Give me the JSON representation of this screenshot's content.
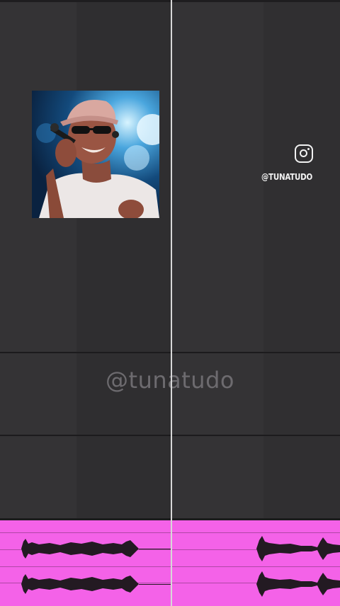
{
  "instagram": {
    "icon": "instagram-icon",
    "handle": "@TUNATUDO"
  },
  "watermark": {
    "text": "@tunatudo"
  },
  "artwork": {
    "icon": "artist-photo",
    "accent": "#f462e8"
  },
  "colors": {
    "background": "#2f2e30",
    "clip": "#f462e8",
    "playhead": "#d8d8d8"
  }
}
